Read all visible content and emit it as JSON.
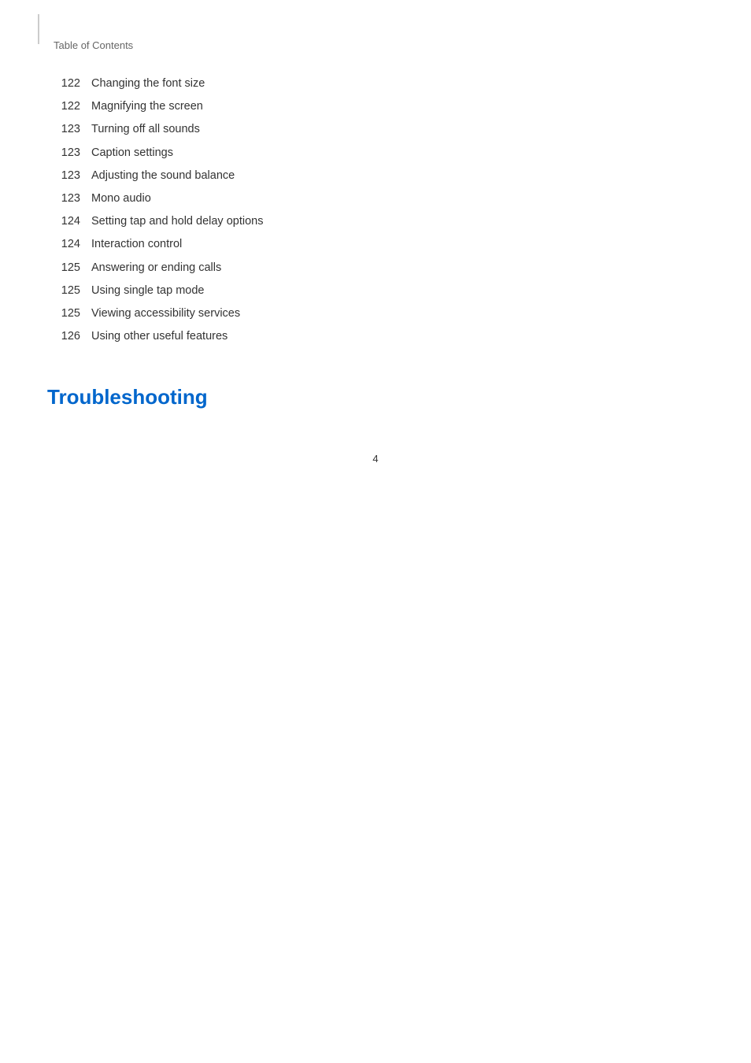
{
  "header": {
    "label": "Table of Contents",
    "border_color": "#cccccc"
  },
  "toc": {
    "items": [
      {
        "page": "122",
        "title": "Changing the font size"
      },
      {
        "page": "122",
        "title": "Magnifying the screen"
      },
      {
        "page": "123",
        "title": "Turning off all sounds"
      },
      {
        "page": "123",
        "title": "Caption settings"
      },
      {
        "page": "123",
        "title": "Adjusting the sound balance"
      },
      {
        "page": "123",
        "title": "Mono audio"
      },
      {
        "page": "124",
        "title": "Setting tap and hold delay options"
      },
      {
        "page": "124",
        "title": "Interaction control"
      },
      {
        "page": "125",
        "title": "Answering or ending calls"
      },
      {
        "page": "125",
        "title": "Using single tap mode"
      },
      {
        "page": "125",
        "title": "Viewing accessibility services"
      },
      {
        "page": "126",
        "title": "Using other useful features"
      }
    ]
  },
  "section": {
    "heading": "Troubleshooting"
  },
  "footer": {
    "page_number": "4"
  }
}
